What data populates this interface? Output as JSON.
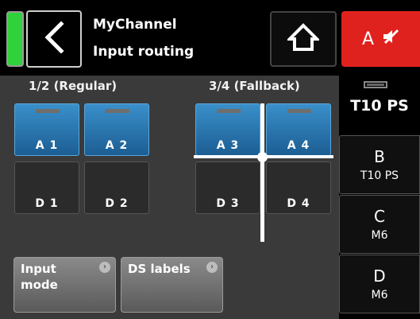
{
  "header": {
    "title": "MyChannel",
    "subtitle": "Input routing",
    "mute_label": "A",
    "icons": [
      "back-arrow-icon",
      "home-icon",
      "speaker-mute-icon"
    ],
    "accent_color": "#e0221e",
    "meter_color": "#2fd23a"
  },
  "groups": {
    "regular_title": "1/2 (Regular)",
    "fallback_title": "3/4 (Fallback)"
  },
  "inputs": {
    "a1": "A 1",
    "a2": "A 2",
    "a3": "A 3",
    "a4": "A 4",
    "d1": "D 1",
    "d2": "D 2",
    "d3": "D 3",
    "d4": "D 4"
  },
  "buttons": {
    "input_mode": "Input\nmode",
    "ds_labels": "DS labels"
  },
  "channels": {
    "current": "T10 PS",
    "list": [
      {
        "name": "B",
        "type": "T10 PS"
      },
      {
        "name": "C",
        "type": "M6"
      },
      {
        "name": "D",
        "type": "M6"
      }
    ]
  },
  "colors": {
    "selected_tile": "#2a7ab6",
    "panel": "#3a3a3a"
  }
}
